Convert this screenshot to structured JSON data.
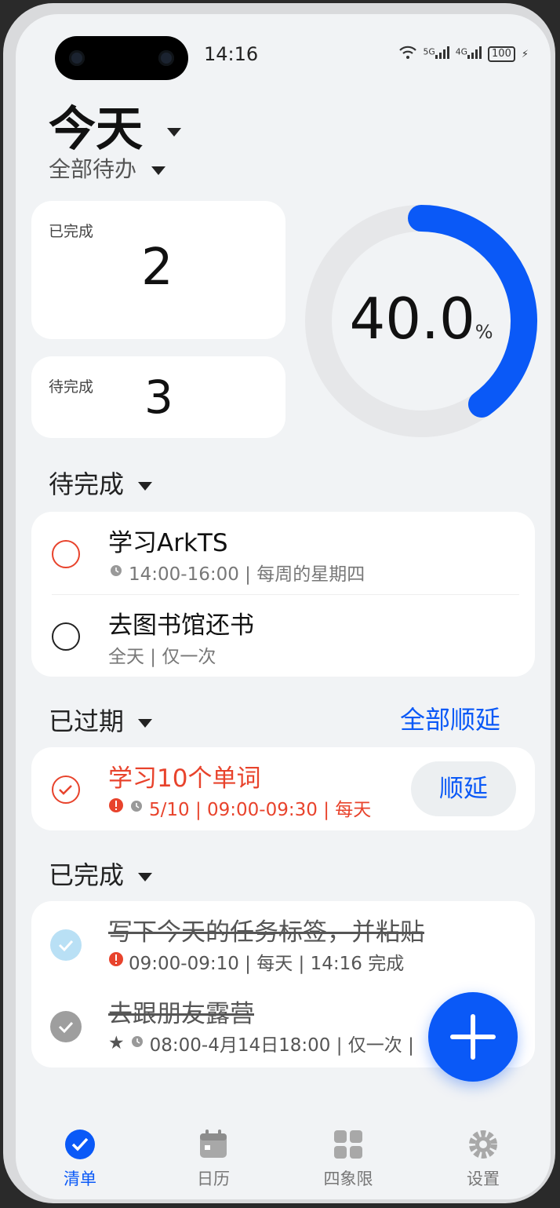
{
  "status": {
    "time": "14:16",
    "net1": "5G",
    "net2": "4G",
    "battery": "100"
  },
  "header": {
    "title": "今天",
    "filter": "全部待办"
  },
  "stats": {
    "done_label": "已完成",
    "done_count": "2",
    "pending_label": "待完成",
    "pending_count": "3"
  },
  "progress": {
    "value": "40.0",
    "unit": "%",
    "fraction": 0.4,
    "color": "#0a59f7"
  },
  "sections": {
    "pending": {
      "title": "待完成",
      "tasks": [
        {
          "title": "学习ArkTS",
          "meta": "14:00-16:00 | 每周的星期四"
        },
        {
          "title": "去图书馆还书",
          "meta": "全天 | 仅一次"
        }
      ]
    },
    "overdue": {
      "title": "已过期",
      "action": "全部顺延",
      "tasks": [
        {
          "title": "学习10个单词",
          "meta": "5/10 | 09:00-09:30 | 每天",
          "action": "顺延"
        }
      ]
    },
    "completed": {
      "title": "已完成",
      "tasks": [
        {
          "title": "写下今天的任务标签，并粘贴",
          "meta": "09:00-09:10 | 每天 | 14:16 完成"
        },
        {
          "title": "去跟朋友露营",
          "meta": "08:00-4月14日18:00 | 仅一次 |"
        }
      ]
    }
  },
  "nav": [
    {
      "label": "清单",
      "icon": "checklist-icon",
      "active": true
    },
    {
      "label": "日历",
      "icon": "calendar-icon"
    },
    {
      "label": "四象限",
      "icon": "grid-icon"
    },
    {
      "label": "设置",
      "icon": "gear-icon"
    }
  ],
  "colors": {
    "accent": "#0a59f7",
    "danger": "#e8432c",
    "done_light": "#b9e0f5",
    "done_gray": "#9e9e9e"
  }
}
